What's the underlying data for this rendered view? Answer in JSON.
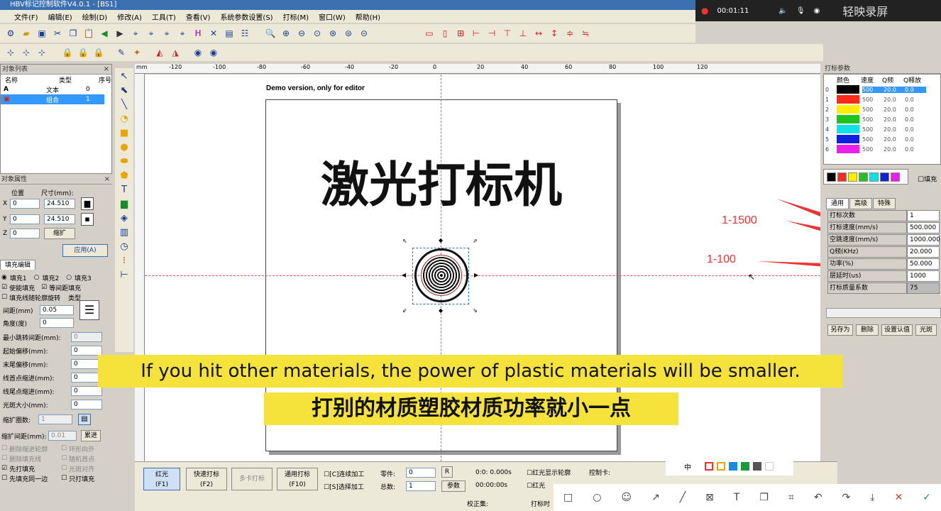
{
  "window": {
    "title": "HBV标记控制软件V4.0.1 - [BS1]"
  },
  "menu": [
    "文件(F)",
    "编辑(E)",
    "绘制(D)",
    "修改(A)",
    "工具(T)",
    "查看(V)",
    "系统参数设置(S)",
    "打标(M)",
    "窗口(W)",
    "帮助(H)"
  ],
  "recorder": {
    "time": "00:01:11",
    "brand": "轻映录屏"
  },
  "object_list": {
    "title": "对象列表",
    "columns": [
      "名称",
      "类型",
      "序号"
    ],
    "rows": [
      {
        "type": "文本",
        "index": "0"
      },
      {
        "type": "组合",
        "index": "1"
      }
    ]
  },
  "object_props": {
    "title": "对象属性",
    "position_label": "位置",
    "size_label": "尺寸(mm):",
    "x_label": "X",
    "x_value": "0",
    "w_value": "24.510",
    "y_label": "Y",
    "y_value": "0",
    "h_value": "24.510",
    "z_label": "Z",
    "z_value": "0",
    "scale_btn": "缩扩",
    "apply_btn": "应用(A)"
  },
  "fill_edit": {
    "tab": "填充编辑",
    "fill1": "填充1",
    "fill2": "填充2",
    "fill3": "填充3",
    "enable_fill": "使能填充",
    "equal_fill": "等间距填充",
    "rotate_fill": "填充线随轮廓旋转",
    "type_label": "类型",
    "spacing_label": "间距(mm)",
    "spacing_value": "0.05",
    "angle_label": "角度(度)",
    "angle_value": "0",
    "min_jump_label": "最小跳转间距(mm):",
    "min_jump_value": "0",
    "start_offset_label": "起始偏移(mm):",
    "start_offset_value": "0",
    "end_offset_label": "末尾偏移(mm):",
    "end_offset_value": "0",
    "head_indent_label": "线首点缩进(mm):",
    "head_indent_value": "0",
    "tail_indent_label": "线尾点缩进(mm):",
    "tail_indent_value": "0",
    "spot_label": "光斑大小(mm):",
    "spot_value": "0",
    "expand_count_label": "缩扩圈数:",
    "expand_count_value": "1",
    "expand_spacing_label": "缩扩间距(mm):",
    "expand_spacing_value": "0.01",
    "cumulative_btn": "累进",
    "del_indent": "删除缩进轮廓",
    "ring_out": "环形向外",
    "del_fill": "删除填充线",
    "random_head": "随机首点",
    "fill_first": "先打填充",
    "spot_align": "光斑对齐",
    "fill_first_edge": "先填充同一边",
    "fill_only": "只打填充"
  },
  "canvas": {
    "demo_text": "Demo version, only for editor",
    "main_text": "激光打标机",
    "ruler_labels": [
      "-120",
      "-100",
      "-80",
      "-60",
      "-40",
      "-20",
      "0",
      "20",
      "40",
      "60",
      "80",
      "100",
      "120"
    ],
    "ruler_unit": "mm"
  },
  "print_params": {
    "title": "打标参数",
    "columns": [
      "颜色",
      "速度",
      "Q频",
      "Q释放"
    ],
    "rows": [
      {
        "idx": "0",
        "color": "#000000",
        "speed": "500",
        "q": "20.0",
        "qr": "0.0"
      },
      {
        "idx": "1",
        "color": "#ff2a1a",
        "speed": "500",
        "q": "20.0",
        "qr": "0.0"
      },
      {
        "idx": "2",
        "color": "#ffee00",
        "speed": "500",
        "q": "20.0",
        "qr": "0.0"
      },
      {
        "idx": "3",
        "color": "#1fc41f",
        "speed": "500",
        "q": "20.0",
        "qr": "0.0"
      },
      {
        "idx": "4",
        "color": "#10e0e8",
        "speed": "500",
        "q": "20.0",
        "qr": "0.0"
      },
      {
        "idx": "5",
        "color": "#1020e0",
        "speed": "500",
        "q": "20.0",
        "qr": "0.0"
      },
      {
        "idx": "6",
        "color": "#e820e8",
        "speed": "500",
        "q": "20.0",
        "qr": "0.0"
      }
    ],
    "palette": [
      "#000000",
      "#ff2a1a",
      "#ffee00",
      "#1fc41f",
      "#10e0e8",
      "#1020e0",
      "#e820e8"
    ],
    "fill_label": "填充",
    "tabs": [
      "通用",
      "高级",
      "特殊"
    ],
    "params": [
      {
        "label": "打标次数",
        "value": "1"
      },
      {
        "label": "打标速度(mm/s)",
        "value": "500.000"
      },
      {
        "label": "空跳速度(mm/s)",
        "value": "1000.000"
      },
      {
        "label": "Q频(KHz)",
        "value": "20.000"
      },
      {
        "label": "功率(%)",
        "value": "50.000"
      },
      {
        "label": "层延时(us)",
        "value": "1000"
      },
      {
        "label": "打标质量系数",
        "value": "75"
      }
    ],
    "buttons": [
      "另存为",
      "删除",
      "设置认值",
      "光斑"
    ]
  },
  "annotations": {
    "range1": "1-1500",
    "range2": "1-100"
  },
  "bottom": {
    "red_light": "红光",
    "red_light_key": "(F1)",
    "quick_mark": "快速打标",
    "quick_mark_key": "(F2)",
    "multi_mark": "多卡打标",
    "general_mark": "通用打标",
    "general_mark_key": "(F10)",
    "continuous": "[C]连续加工",
    "selective": "[S]选择加工",
    "parts_label": "零件:",
    "parts_value": "0",
    "total_label": "总数:",
    "total_value": "1",
    "r_btn": "R",
    "param_btn": "参数",
    "time1": "0:0: 0.000s",
    "time2": "00:00:00s",
    "red_contour": "红光显示轮廓",
    "red_light2": "红光",
    "card_label": "控制卡:",
    "calib_label": "校正集:",
    "mark_time_label": "打标时"
  },
  "captions": {
    "en": "If you hit other materials, the power of plastic materials will be smaller.",
    "zh": "打别的材质塑胶材质功率就小一点"
  },
  "annot_toolbar": {
    "lang": "中"
  }
}
